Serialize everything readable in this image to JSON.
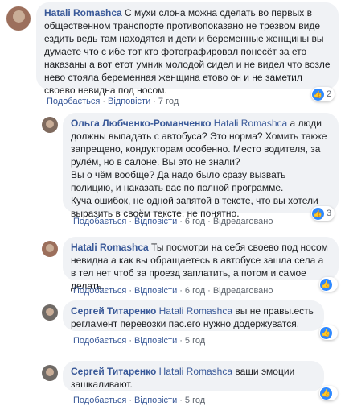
{
  "comments": [
    {
      "author": "Hatali Romashca",
      "text": "С мухи слона можна сделать во первых в общественном транспорте противопоказано не трезвом виде ездить ведь там находятся и дети и беременные женщины вы думаете что с ибе тот кто фотографировал понесёт за ето наказаны а вот етот умник молодой сидел и не видел что возле нево стояла беременная женщина етово он и не заметил своево невидна под носом.",
      "actions": {
        "like": "Подобається",
        "reply": "Відповісти",
        "time": "7 год"
      },
      "reactions": {
        "icon": "like-icon",
        "count": "2"
      }
    },
    {
      "author": "Ольга Любченко-Романченко",
      "mention": "Hatali Romashca",
      "text": "а люди должны выпадать с автобуса? Это норма? Хомить также запрещено, кондукторам особенно. Место водителя, за рулём, но в салоне. Вы это не знали?\nВы о чём вообще? Да надо было сразу вызвать полицию, и наказать вас по полной программе.\nКуча ошибок, не одной запятой в тексте, что вы хотели выразить в своём тексте, не понятно.",
      "actions": {
        "like": "Подобається",
        "reply": "Відповісти",
        "time": "6 год",
        "edited": "Відредаговано"
      },
      "reactions": {
        "icon": "like-icon",
        "count": "3"
      }
    },
    {
      "author": "Hatali Romashca",
      "text": "Ты посмотри на себя своево под носом невидна а как вы обращаетесь в автобусе зашла села а в тел нет чтоб за проезд заплатить, а потом и самое делать.",
      "actions": {
        "like": "Подобається",
        "reply": "Відповісти",
        "time": "6 год",
        "edited": "Відредаговано"
      },
      "reactions": {
        "icon": "like-icon",
        "count": ""
      }
    },
    {
      "author": "Сергей Титаренко",
      "mention": "Hatali Romashca",
      "text": "вы не правы.есть регламент перевозки пас.его нужно додержуватся.",
      "actions": {
        "like": "Подобається",
        "reply": "Відповісти",
        "time": "5 год"
      },
      "reactions": {
        "icon": "like-icon",
        "count": ""
      }
    },
    {
      "author": "Сергей Титаренко",
      "mention": "Hatali Romashca",
      "text": "ваши эмоции зашкаливают.",
      "actions": {
        "like": "Подобається",
        "reply": "Відповісти",
        "time": "5 год"
      },
      "reactions": {
        "icon": "like-icon",
        "count": ""
      }
    }
  ]
}
